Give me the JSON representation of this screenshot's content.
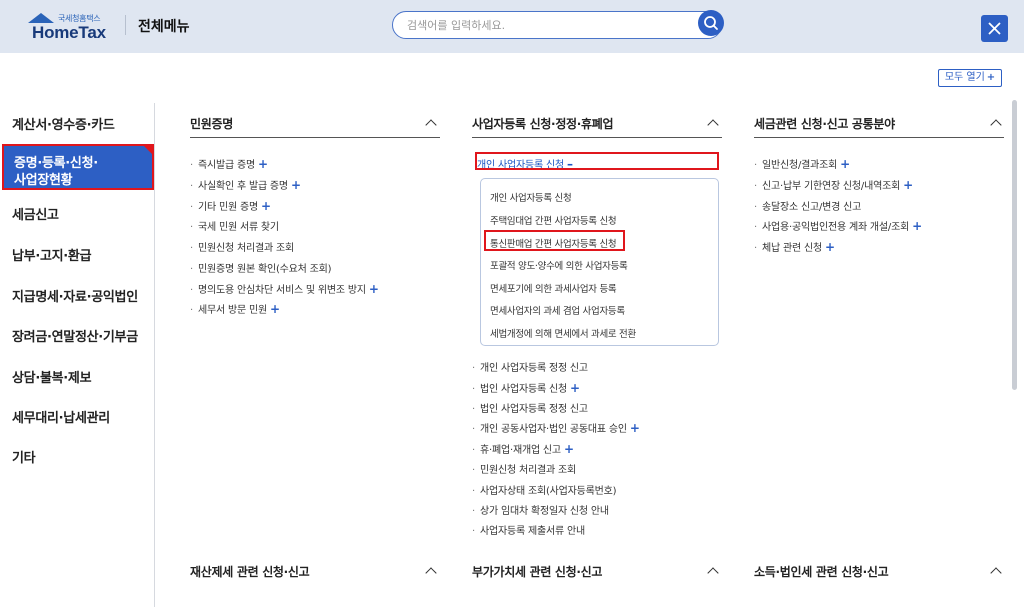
{
  "header": {
    "logo_small": "국세청홈택스",
    "logo_text": "HomeTax",
    "title": "전체메뉴"
  },
  "search": {
    "placeholder": "검색어를 입력하세요."
  },
  "open_all": {
    "label": "모두 열기"
  },
  "left_nav": [
    "계산서·영수증·카드",
    "세금신고",
    "납부·고지·환급",
    "지급명세·자료·공익법인",
    "장려금·연말정산·기부금",
    "상담·불복·제보",
    "세무대리·납세관리",
    "기타"
  ],
  "left_nav_active": {
    "line1": "증명·등록·신청·",
    "line2": "사업장현황"
  },
  "col1": {
    "title": "민원증명",
    "items": [
      "즉시발급 증명",
      "사실확인 후 발급 증명",
      "기타 민원 증명",
      "국세 민원 서류 찾기",
      "민원신청 처리결과 조회",
      "민원증명 원본 확인(수요처 조회)",
      "명의도용 안심차단 서비스 및 위변조 방지",
      "세무서 방문 민원"
    ]
  },
  "col2": {
    "title": "사업자등록 신청·정정·휴폐업",
    "expanded_item": "개인 사업자등록 신청",
    "sub_items": [
      "개인 사업자등록 신청",
      "주택임대업 간편 사업자등록 신청",
      "통신판매업 간편 사업자등록 신청",
      "포괄적 양도·양수에 의한 사업자등록",
      "면세포기에 의한 과세사업자 등록",
      "면세사업자의 과세 겸업 사업자등록",
      "세법개정에 의해 면세에서 과세로 전환"
    ],
    "items": [
      "개인 사업자등록 정정 신고",
      "법인 사업자등록 신청",
      "법인 사업자등록 정정 신고",
      "개인 공동사업자·법인 공동대표 승인",
      "휴·폐업·재개업 신고",
      "민원신청 처리결과 조회",
      "사업자상태 조회(사업자등록번호)",
      "상가 임대차 확정일자 신청 안내",
      "사업자등록 제출서류 안내"
    ]
  },
  "col3": {
    "title": "세금관련 신청·신고 공통분야",
    "items": [
      "일반신청/결과조회",
      "신고·납부 기한연장 신청/내역조회",
      "송달장소 신고/변경 신고",
      "사업용·공익법인전용 계좌 개설/조회",
      "체납 관련 신청"
    ]
  },
  "bottom": [
    "재산제세 관련 신청·신고",
    "부가가치세 관련 신청·신고",
    "소득·법인세 관련 신청·신고"
  ],
  "colors": {
    "primary": "#2d5fc4",
    "highlight_border": "#e0161c",
    "header_bg": "#dfe6f1"
  }
}
